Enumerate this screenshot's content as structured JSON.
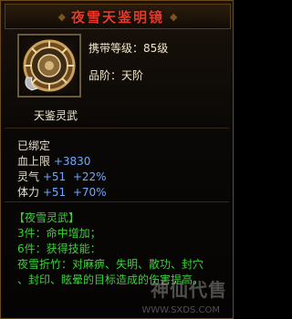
{
  "tooltip": {
    "title": "夜雪天鉴明镜",
    "carry_level": "携带等级：85级",
    "grade": "品阶：天阶",
    "item_name": "天鉴灵武"
  },
  "status": {
    "bound": "已绑定"
  },
  "stats": [
    {
      "label": "血上限",
      "value": "+3830",
      "bonus": ""
    },
    {
      "label": "灵气",
      "value": "+51",
      "bonus": "+22%"
    },
    {
      "label": "体力",
      "value": "+51",
      "bonus": "+70%"
    }
  ],
  "set": {
    "name": "【夜雪灵武】",
    "bonus_3": "3件：命中增加；",
    "bonus_6": "6件：获得技能：",
    "skill_line1": "夜雪折竹：对麻痹、失明、散功、封穴",
    "skill_line2": "、封印、眩晕的目标造成的伤害提高。"
  },
  "watermark": {
    "text": "神仙代售",
    "url": "WWW.SXDS.COM"
  },
  "icon": {
    "name": "bronze-mirror-icon"
  }
}
